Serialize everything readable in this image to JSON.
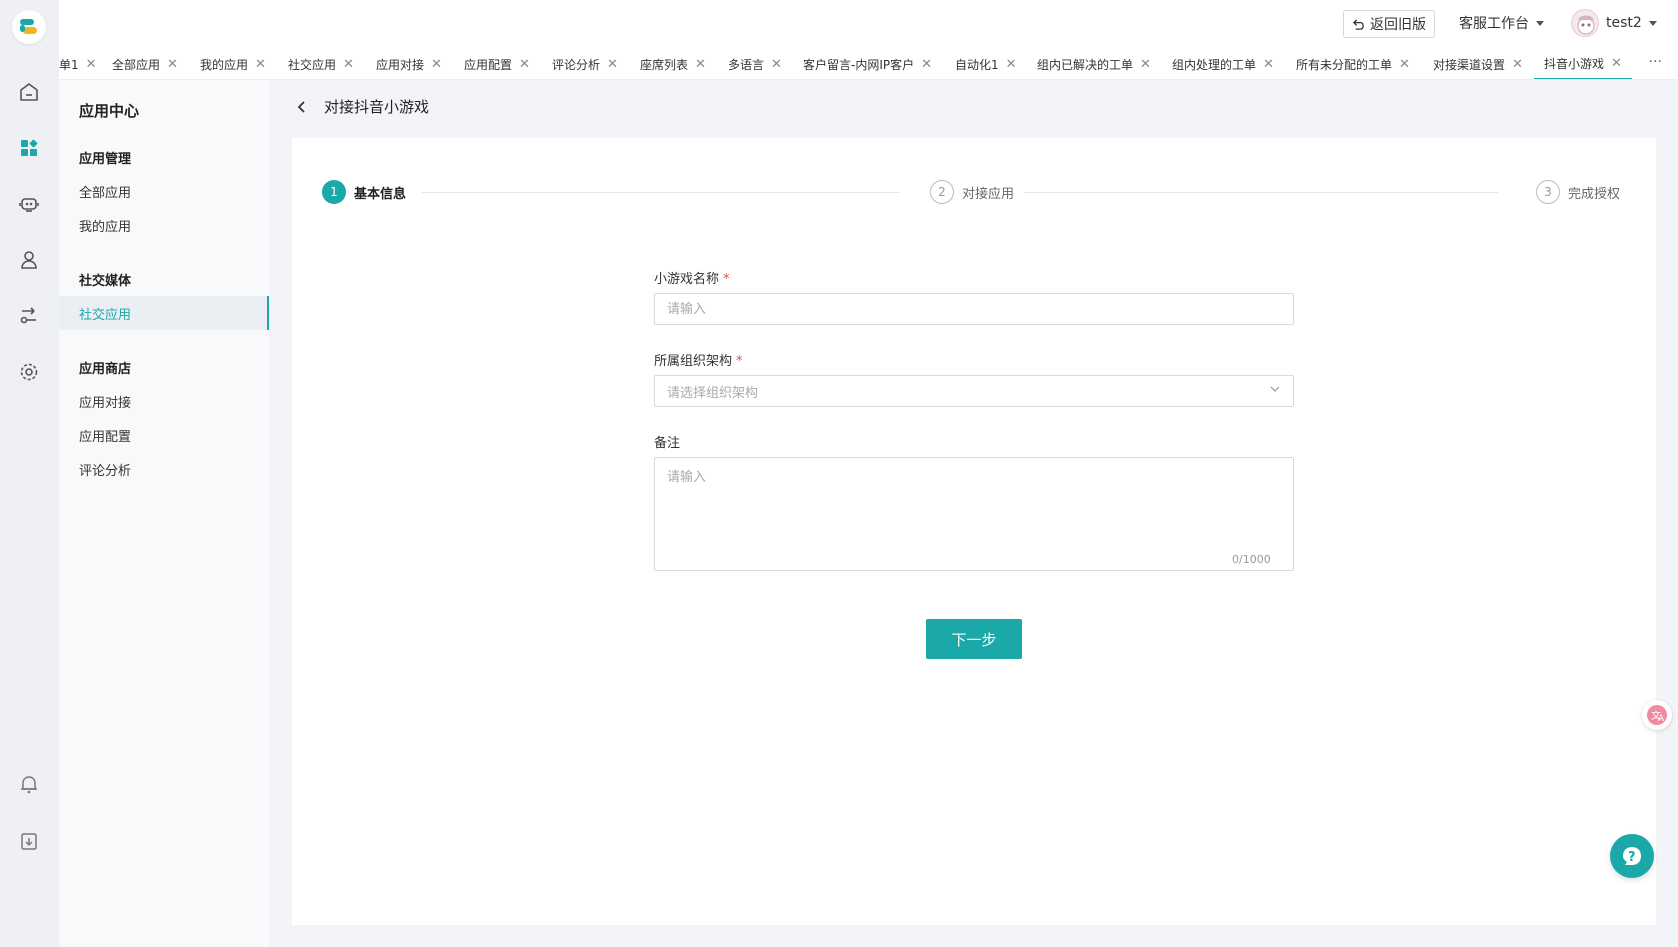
{
  "topbar": {
    "old_version_label": "返回旧版",
    "workbench_label": "客服工作台",
    "username": "test2"
  },
  "tabs": {
    "items": [
      {
        "label": "单1"
      },
      {
        "label": "全部应用"
      },
      {
        "label": "我的应用"
      },
      {
        "label": "社交应用"
      },
      {
        "label": "应用对接"
      },
      {
        "label": "应用配置"
      },
      {
        "label": "评论分析"
      },
      {
        "label": "座席列表"
      },
      {
        "label": "多语言"
      },
      {
        "label": "客户留言-内网IP客户"
      },
      {
        "label": "自动化1"
      },
      {
        "label": "组内已解决的工单"
      },
      {
        "label": "组内处理的工单"
      },
      {
        "label": "所有未分配的工单"
      },
      {
        "label": "对接渠道设置"
      },
      {
        "label": "抖音小游戏"
      }
    ],
    "more": "···"
  },
  "submenu": {
    "title": "应用中心",
    "groups": [
      {
        "label": "应用管理",
        "items": [
          {
            "label": "全部应用"
          },
          {
            "label": "我的应用"
          }
        ]
      },
      {
        "label": "社交媒体",
        "items": [
          {
            "label": "社交应用"
          }
        ]
      },
      {
        "label": "应用商店",
        "items": [
          {
            "label": "应用对接"
          },
          {
            "label": "应用配置"
          },
          {
            "label": "评论分析"
          }
        ]
      }
    ]
  },
  "page": {
    "title": "对接抖音小游戏"
  },
  "steps": [
    {
      "num": "1",
      "label": "基本信息"
    },
    {
      "num": "2",
      "label": "对接应用"
    },
    {
      "num": "3",
      "label": "完成授权"
    }
  ],
  "form": {
    "name_label": "小游戏名称",
    "name_placeholder": "请输入",
    "org_label": "所属组织架构",
    "org_placeholder": "请选择组织架构",
    "remark_label": "备注",
    "remark_placeholder": "请输入",
    "remark_counter": "0/1000",
    "required_mark": "*",
    "next_label": "下一步"
  },
  "colors": {
    "accent": "#1aa8a8",
    "required": "#e04b4b"
  }
}
